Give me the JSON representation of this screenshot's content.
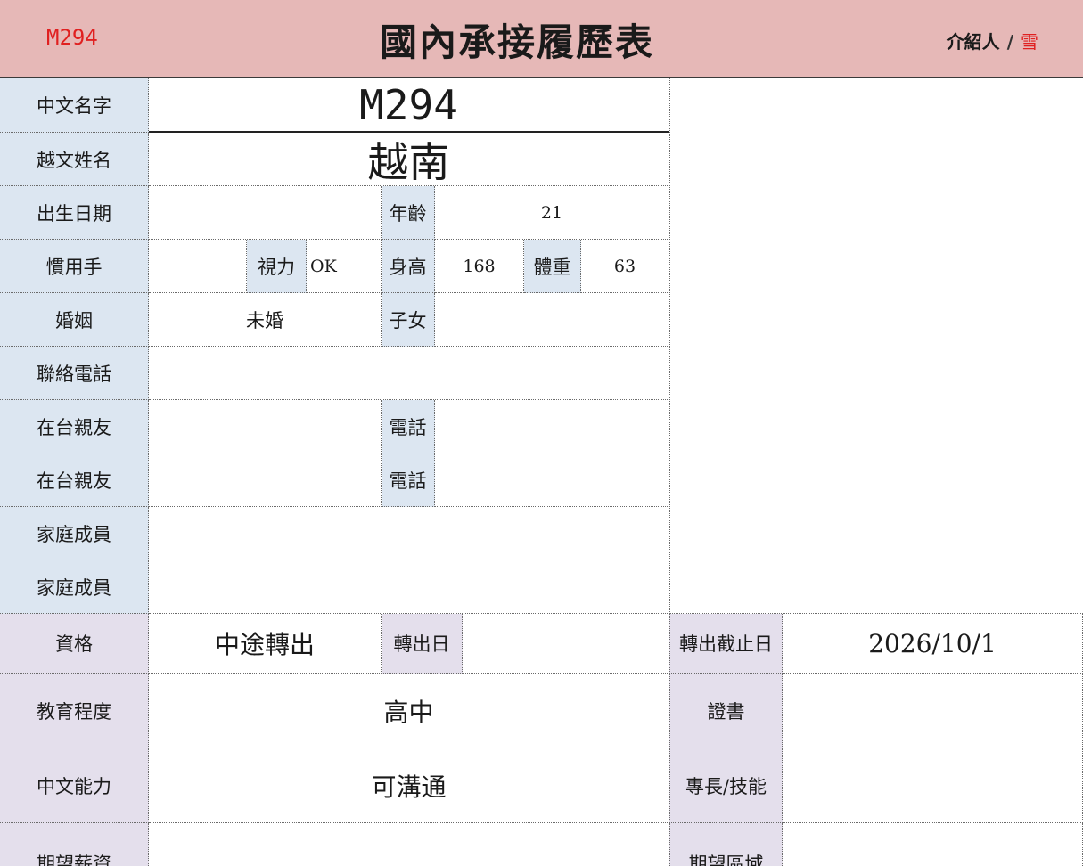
{
  "header": {
    "code": "M294",
    "title": "國內承接履歷表",
    "introducer_label": "介紹人",
    "separator": "/",
    "introducer_value": "雪"
  },
  "labels": {
    "chinese_name": "中文名字",
    "viet_name": "越文姓名",
    "birthday": "出生日期",
    "age": "年齡",
    "handedness": "慣用手",
    "vision": "視力",
    "height": "身高",
    "weight": "體重",
    "marriage": "婚姻",
    "children": "子女",
    "phone": "聯絡電話",
    "relative_1": "在台親友",
    "relative_1_phone": "電話",
    "relative_2": "在台親友",
    "relative_2_phone": "電話",
    "family_1": "家庭成員",
    "family_2": "家庭成員",
    "qualification": "資格",
    "transfer_date": "轉出日",
    "transfer_deadline": "轉出截止日",
    "education": "教育程度",
    "certificate": "證書",
    "chinese_ability": "中文能力",
    "skills": "專長/技能",
    "expected_salary": "期望薪資",
    "expected_area": "期望區域"
  },
  "values": {
    "chinese_name": "M294",
    "viet_name": "越南",
    "birthday": "",
    "age": "21",
    "handedness": "",
    "vision": "OK",
    "height": "168",
    "weight": "63",
    "marriage": "未婚",
    "children": "",
    "phone": "",
    "relative_1": "",
    "relative_1_phone": "",
    "relative_2": "",
    "relative_2_phone": "",
    "family_1": "",
    "family_2": "",
    "qualification": "中途轉出",
    "transfer_date": "",
    "transfer_deadline": "2026/10/1",
    "education": "高中",
    "certificate": "",
    "chinese_ability": "可溝通",
    "skills": "",
    "expected_salary": "",
    "expected_area": ""
  },
  "colors": {
    "header_bg": "#e6b8b7",
    "label_blue": "#dce6f1",
    "label_lavender": "#e4dfec",
    "accent_red": "#e02020"
  }
}
